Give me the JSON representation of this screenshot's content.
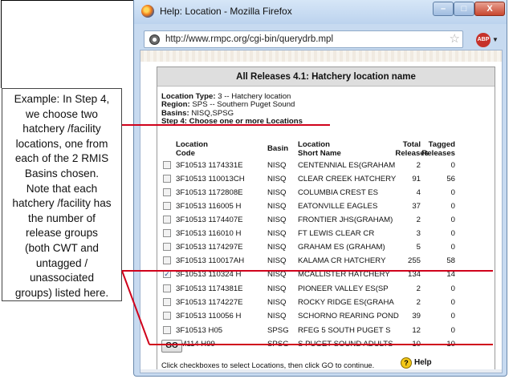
{
  "colors": {
    "highlight_line": "#d0021b",
    "titlebar": "#c7daf0",
    "panel_header": "#dedede"
  },
  "callout": {
    "lines": [
      "Example:  In Step 4,",
      "we choose two",
      "hatchery /facility",
      "locations, one from",
      "each of the 2 RMIS",
      "Basins chosen.",
      "Note that each",
      "hatchery /facility has",
      "the number of",
      "release groups",
      "(both CWT and",
      "untagged /",
      "unassociated",
      "groups) listed here."
    ]
  },
  "window": {
    "title": "Help: Location - Mozilla Firefox",
    "url": "http://www.rmpc.org/cgi-bin/querydrb.mpl",
    "minimize_label": "–",
    "maximize_label": "□",
    "close_label": "X",
    "addon_label": "ABP"
  },
  "panel": {
    "title": "All Releases 4.1: Hatchery location name",
    "location_type_label": "Location Type:",
    "location_type_value": "3 -- Hatchery location",
    "region_label": "Region:",
    "region_value": "SPS -- Southern Puget Sound",
    "basins_label": "Basins:",
    "basins_value": "NISQ,SPSG",
    "step_label": "Step 4: Choose one or more Locations",
    "headers": {
      "code": [
        "Location",
        "Code"
      ],
      "basin": "Basin",
      "name": [
        "Location",
        "Short Name"
      ],
      "total": [
        "Total",
        "Releases"
      ],
      "tagged": [
        "Tagged",
        "Releases"
      ]
    },
    "rows": [
      {
        "checked": false,
        "code": "3F10513 1174331E",
        "basin": "NISQ",
        "name": "CENTENNIAL ES(GRAHAM",
        "total": "2",
        "tagged": "0"
      },
      {
        "checked": false,
        "code": "3F10513 110013CH",
        "basin": "NISQ",
        "name": "CLEAR CREEK HATCHERY",
        "total": "91",
        "tagged": "56"
      },
      {
        "checked": false,
        "code": "3F10513 1172808E",
        "basin": "NISQ",
        "name": "COLUMBIA CREST ES",
        "total": "4",
        "tagged": "0"
      },
      {
        "checked": false,
        "code": "3F10513 116005 H",
        "basin": "NISQ",
        "name": "EATONVILLE EAGLES",
        "total": "37",
        "tagged": "0"
      },
      {
        "checked": false,
        "code": "3F10513 1174407E",
        "basin": "NISQ",
        "name": "FRONTIER JHS(GRAHAM)",
        "total": "2",
        "tagged": "0"
      },
      {
        "checked": false,
        "code": "3F10513 116010 H",
        "basin": "NISQ",
        "name": "FT LEWIS CLEAR CR",
        "total": "3",
        "tagged": "0"
      },
      {
        "checked": false,
        "code": "3F10513 1174297E",
        "basin": "NISQ",
        "name": "GRAHAM ES (GRAHAM)",
        "total": "5",
        "tagged": "0"
      },
      {
        "checked": false,
        "code": "3F10513 110017AH",
        "basin": "NISQ",
        "name": "KALAMA CR HATCHERY",
        "total": "255",
        "tagged": "58"
      },
      {
        "checked": true,
        "code": "3F10513 110324 H",
        "basin": "NISQ",
        "name": "MCALLISTER HATCHERY",
        "total": "134",
        "tagged": "14"
      },
      {
        "checked": false,
        "code": "3F10513 1174381E",
        "basin": "NISQ",
        "name": "PIONEER VALLEY ES(SP",
        "total": "2",
        "tagged": "0"
      },
      {
        "checked": false,
        "code": "3F10513 1174227E",
        "basin": "NISQ",
        "name": "ROCKY RIDGE ES(GRAHA",
        "total": "2",
        "tagged": "0"
      },
      {
        "checked": false,
        "code": "3F10513 110056 H",
        "basin": "NISQ",
        "name": "SCHORNO REARING POND",
        "total": "39",
        "tagged": "0"
      },
      {
        "checked": false,
        "code": "3F10513 H05",
        "basin": "SPSG",
        "name": "RFEG 5 SOUTH PUGET S",
        "total": "12",
        "tagged": "0"
      },
      {
        "checked": true,
        "code": "3M114 H99",
        "basin": "SPSG",
        "name": "S PUGET SOUND ADULTS",
        "total": "10",
        "tagged": "10"
      }
    ],
    "go_label": "GO",
    "footer_text": "Click checkboxes to select Locations, then click GO to continue.",
    "help_icon": "?",
    "help_label": "Help"
  }
}
